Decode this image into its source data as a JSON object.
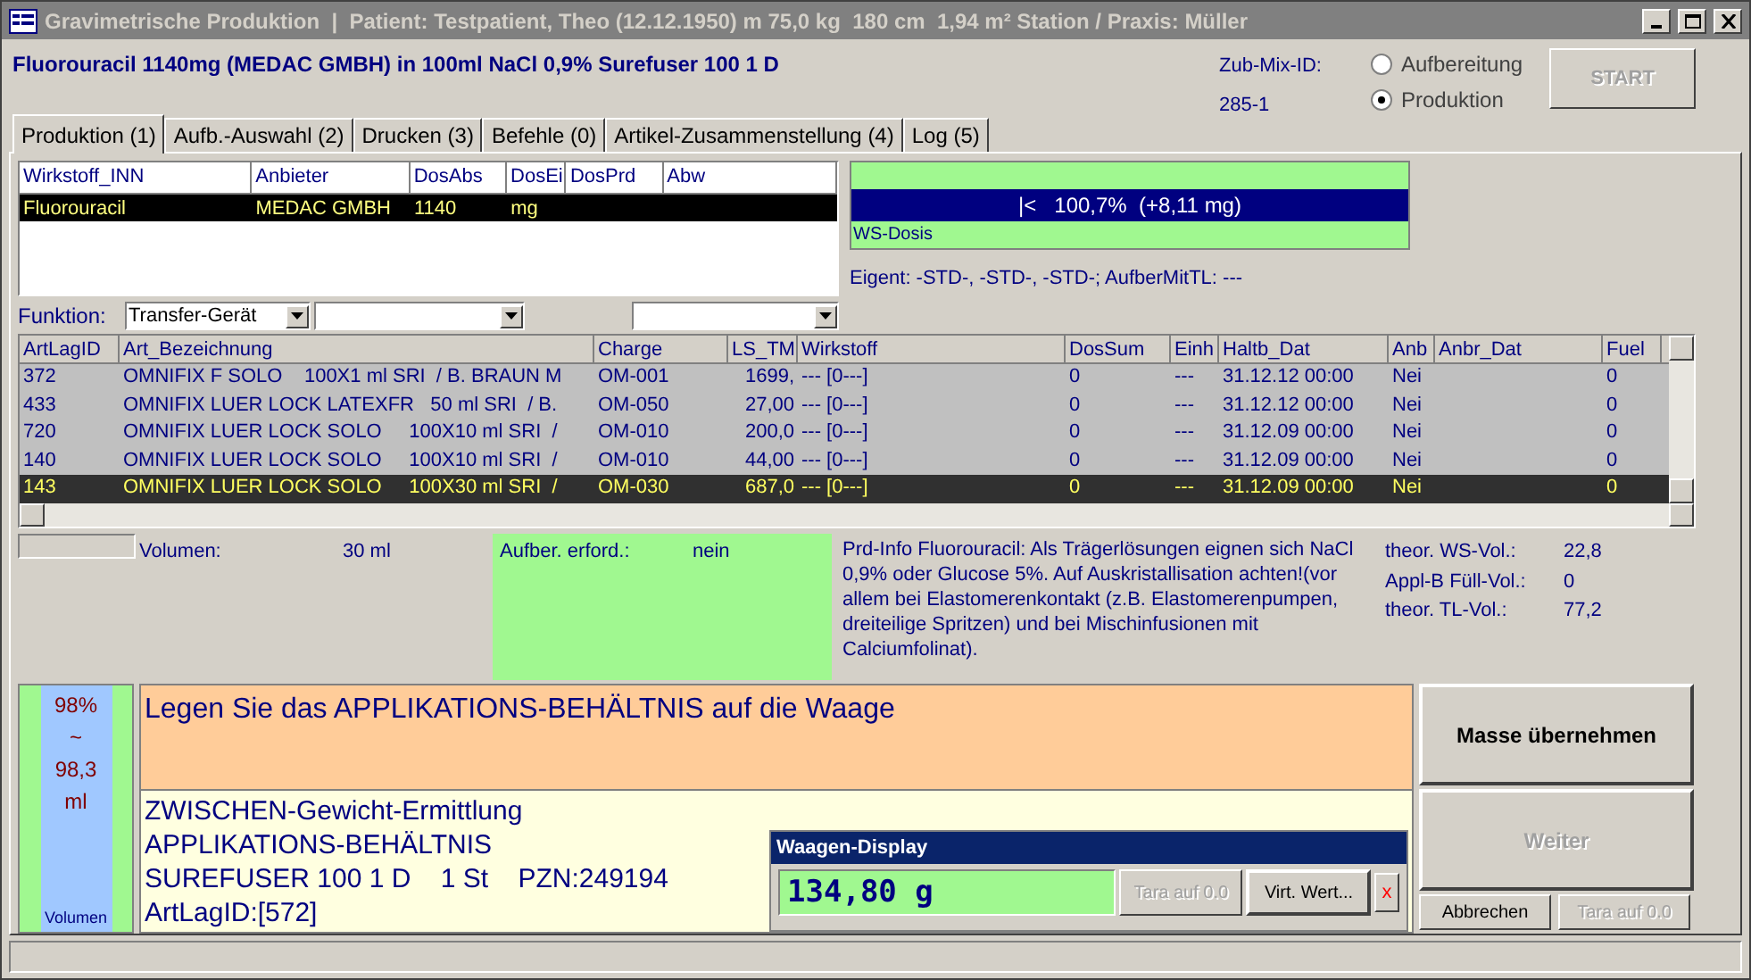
{
  "window": {
    "title": "Gravimetrische Produktion  |  Patient: Testpatient, Theo (12.12.1950) m 75,0 kg  180 cm  1,94 m² Station / Praxis: Müller"
  },
  "header": {
    "product": "Fluorouracil 1140mg (MEDAC GMBH) in 100ml NaCl 0,9% Surefuser 100 1 D",
    "mix_id_label": "Zub-Mix-ID:",
    "mix_id": "285-1",
    "modes": [
      {
        "label": "Aufbereitung",
        "selected": false
      },
      {
        "label": "Produktion",
        "selected": true
      }
    ],
    "start_button": {
      "label": "START",
      "disabled": true
    }
  },
  "tabs": [
    {
      "label": "Produktion (1)",
      "selected": true
    },
    {
      "label": "Aufb.-Auswahl (2)",
      "selected": false
    },
    {
      "label": "Drucken (3)",
      "selected": false
    },
    {
      "label": "Befehle (0)",
      "selected": false
    },
    {
      "label": "Artikel-Zusammenstellung (4)",
      "selected": false
    },
    {
      "label": "Log (5)",
      "selected": false
    }
  ],
  "substance_table": {
    "columns": [
      "Wirkstoff_INN",
      "Anbieter",
      "DosAbs",
      "DosEi",
      "DosPrd",
      "Abw"
    ],
    "rows": [
      {
        "cells": [
          "Fluorouracil",
          "MEDAC GMBH",
          "1140",
          "mg",
          "",
          ""
        ],
        "selected": true
      }
    ]
  },
  "dose_meter": {
    "reading": "|<   100,7%  (+8,11 mg)",
    "label": "WS-Dosis"
  },
  "properties": "Eigent: -STD-, -STD-, -STD-; AufberMitTL: ---",
  "function": {
    "label": "Funktion:",
    "value": "Transfer-Gerät"
  },
  "article_table": {
    "columns": [
      "ArtLagID",
      "Art_Bezeichnung",
      "Charge",
      "LS_TM",
      "Wirkstoff",
      "DosSum",
      "Einh",
      "Haltb_Dat",
      "Anb",
      "Anbr_Dat",
      "Fuel"
    ],
    "rows": [
      {
        "cells": [
          "372",
          "OMNIFIX F SOLO    100X1 ml SRI  / B. BRAUN M",
          "OM-001",
          "1699,",
          "--- [0---]",
          "0",
          "---",
          "31.12.12 00:00",
          "Nei",
          "",
          "0"
        ],
        "selected": false
      },
      {
        "cells": [
          "433",
          "OMNIFIX LUER LOCK LATEXFR   50 ml SRI  / B.",
          "OM-050",
          "27,00",
          "--- [0---]",
          "0",
          "---",
          "31.12.12 00:00",
          "Nei",
          "",
          "0"
        ],
        "selected": false
      },
      {
        "cells": [
          "720",
          "OMNIFIX LUER LOCK SOLO     100X10 ml SRI  /",
          "OM-010",
          "200,0",
          "--- [0---]",
          "0",
          "---",
          "31.12.09 00:00",
          "Nei",
          "",
          "0"
        ],
        "selected": false
      },
      {
        "cells": [
          "140",
          "OMNIFIX LUER LOCK SOLO     100X10 ml SRI  /",
          "OM-010",
          "44,00",
          "--- [0---]",
          "0",
          "---",
          "31.12.09 00:00",
          "Nei",
          "",
          "0"
        ],
        "selected": false
      },
      {
        "cells": [
          "143",
          "OMNIFIX LUER LOCK SOLO     100X30 ml SRI  /",
          "OM-030",
          "687,0",
          "--- [0---]",
          "0",
          "---",
          "31.12.09 00:00",
          "Nei",
          "",
          "0"
        ],
        "selected": true
      }
    ]
  },
  "info": {
    "volume_label": "Volumen:",
    "volume": "30 ml",
    "prep_label": "Aufber. erford.:",
    "prep": "nein",
    "prd_info": "Prd-Info Fluorouracil: Als Trägerlösungen eignen sich NaCl 0,9% oder Glucose 5%. Auf Auskristallisation achten!(vor allem bei Elastomerenkontakt (z.B. Elastomerenpumpen, dreiteilige Spritzen) und bei Mischinfusionen mit Calciumfolinat).",
    "volumes": [
      {
        "label": "theor. WS-Vol.:",
        "value": "22,8"
      },
      {
        "label": "Appl-B Füll-Vol.:",
        "value": "0"
      },
      {
        "label": "theor. TL-Vol.:",
        "value": "77,2"
      }
    ]
  },
  "volume_gauge": {
    "percent": "98%",
    "approx": "~",
    "amount": "98,3",
    "unit": "ml",
    "label": "Volumen"
  },
  "instruction": "Legen Sie das APPLIKATIONS-BEHÄLTNIS auf die Waage",
  "details": [
    "ZWISCHEN-Gewicht-Ermittlung",
    "APPLIKATIONS-BEHÄLTNIS",
    "SUREFUSER 100 1 D    1 St    PZN:249194",
    "ArtLagID:[572]"
  ],
  "scale": {
    "title": "Waagen-Display",
    "weight": "134,80 g",
    "buttons": [
      {
        "label": "Tara auf 0.0",
        "disabled": true
      },
      {
        "label": "Virt. Wert...",
        "disabled": false
      }
    ],
    "close": "x"
  },
  "actions": [
    {
      "label": "Masse übernehmen",
      "disabled": false
    },
    {
      "label": "Weiter",
      "disabled": true
    }
  ],
  "bottom_buttons": [
    {
      "label": "Abbrechen",
      "disabled": false
    },
    {
      "label": "Tara auf 0.0",
      "disabled": true
    }
  ]
}
